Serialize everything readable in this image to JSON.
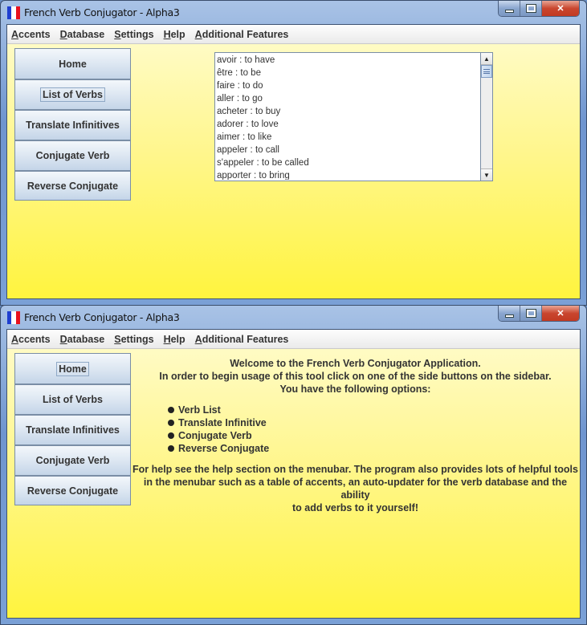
{
  "app": {
    "title": "French Verb Conjugator - Alpha3",
    "flag_colors": [
      "#1f3fd1",
      "#ffffff",
      "#e8111e"
    ]
  },
  "menubar": {
    "items": [
      {
        "label": "Accents",
        "mnemonic": "A",
        "rest": "ccents"
      },
      {
        "label": "Database",
        "mnemonic": "D",
        "rest": "atabase"
      },
      {
        "label": "Settings",
        "mnemonic": "S",
        "rest": "ettings"
      },
      {
        "label": "Help",
        "mnemonic": "H",
        "rest": "elp"
      },
      {
        "label": "Additional Features",
        "mnemonic": "A",
        "rest": "dditional Features"
      }
    ]
  },
  "sidebar": {
    "buttons": [
      {
        "label": "Home"
      },
      {
        "label": "List of Verbs"
      },
      {
        "label": "Translate Infinitives"
      },
      {
        "label": "Conjugate Verb"
      },
      {
        "label": "Reverse Conjugate"
      }
    ]
  },
  "window1": {
    "focused_button": "List of Verbs",
    "verb_list": [
      "avoir : to have",
      "être : to be",
      "faire : to do",
      "aller : to go",
      "acheter : to buy",
      "adorer : to love",
      "aimer : to like",
      "appeler : to call",
      "s'appeler : to be called",
      "apporter : to bring"
    ],
    "scroll_position_fraction": 0.0
  },
  "window2": {
    "focused_button": "Home",
    "welcome_lines": [
      "Welcome to the French Verb Conjugator Application.",
      "In order to begin usage of this tool click on one of the side buttons on the sidebar.",
      "You have the following options:"
    ],
    "options": [
      "Verb List",
      "Translate Infinitive",
      "Conjugate Verb",
      "Reverse Conjugate"
    ],
    "help_lines": [
      "For help see the help section on the menubar. The program also provides lots of helpful tools",
      "in the menubar such as a table of accents, an auto-updater for the verb database and the ability",
      "to add verbs to it yourself!"
    ]
  }
}
